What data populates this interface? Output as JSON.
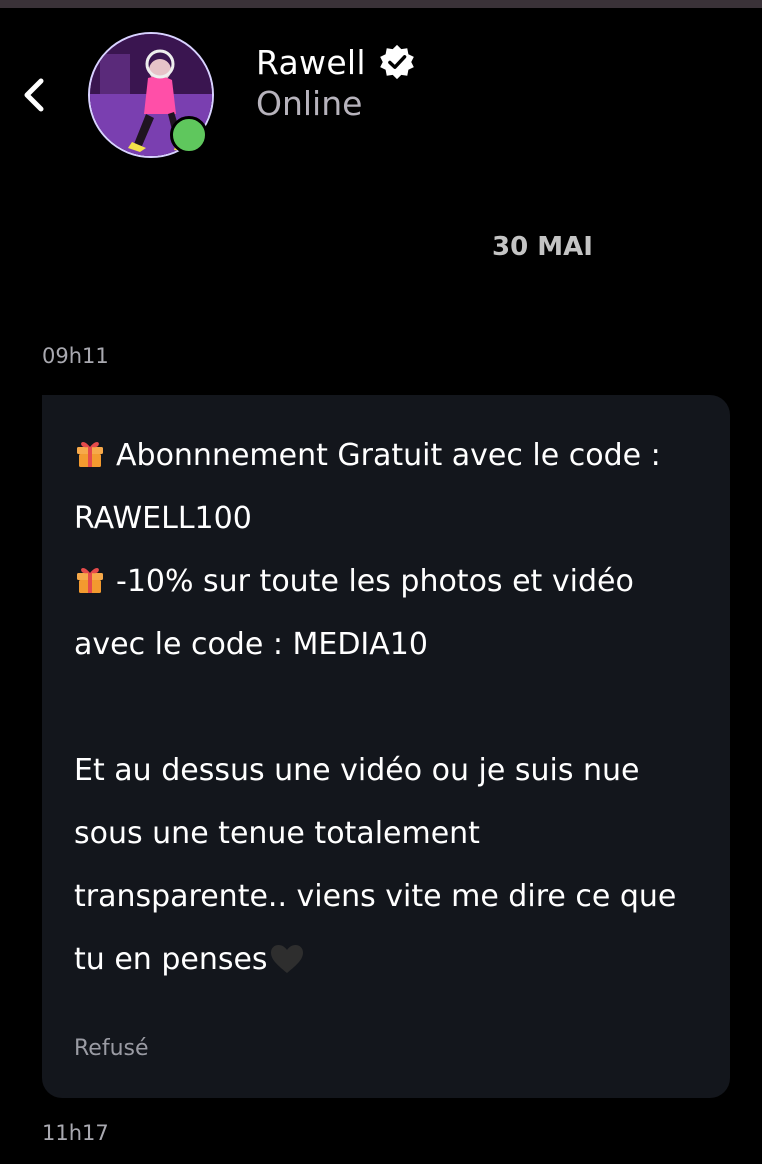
{
  "header": {
    "name": "Rawell",
    "status": "Online",
    "verified_icon": "verified-badge-icon",
    "back_icon": "chevron-left-icon"
  },
  "conversation": {
    "date_separator": "30 MAI",
    "messages": [
      {
        "time": "09h11",
        "lines": [
          "Abonnnement Gratuit avec le code :",
          "RAWELL100",
          "-10% sur toute les photos et vidéo",
          "avec le code : MEDIA10",
          "",
          "Et au dessus une vidéo ou je suis nue",
          "sous une tenue totalement",
          "transparente.. viens vite me dire ce que",
          "tu en penses"
        ],
        "delivery_status": "Refusé"
      }
    ],
    "next_time": "11h17"
  },
  "colors": {
    "background": "#000000",
    "bubble": "#13161c",
    "online": "#5fc75d",
    "muted_text": "#b7b3bc"
  }
}
